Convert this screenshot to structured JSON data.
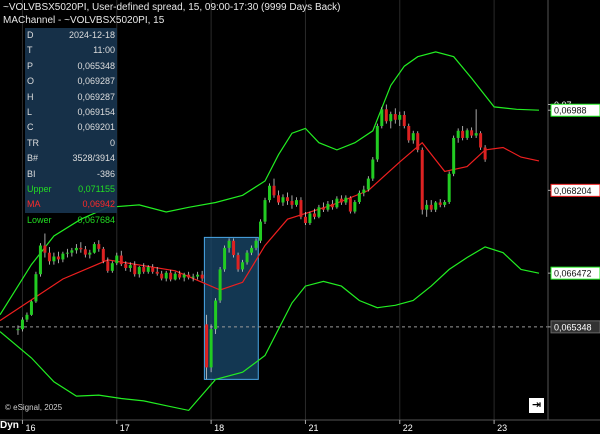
{
  "header": {
    "line1": "~VOLVBSX5020PI, User-defined spread, 15, 09:00-17:30 (9999 Days Back)",
    "line2": "MAChannel - ~VOLVBSX5020PI, 15"
  },
  "data_window": {
    "rows": [
      {
        "key": "D",
        "value": "2024-12-18",
        "color": ""
      },
      {
        "key": "T",
        "value": "11:00",
        "color": ""
      },
      {
        "key": "P",
        "value": "0,065348",
        "color": ""
      },
      {
        "key": "O",
        "value": "0,069287",
        "color": ""
      },
      {
        "key": "H",
        "value": "0,069287",
        "color": ""
      },
      {
        "key": "L",
        "value": "0,069154",
        "color": ""
      },
      {
        "key": "C",
        "value": "0,069201",
        "color": ""
      },
      {
        "key": "TR",
        "value": "0",
        "color": ""
      },
      {
        "key": "B#",
        "value": "3528/3914",
        "color": ""
      },
      {
        "key": "BI",
        "value": "-386",
        "color": ""
      },
      {
        "key": "Upper",
        "value": "0,071155",
        "color": "green"
      },
      {
        "key": "MA",
        "value": "0,06942",
        "color": "red"
      },
      {
        "key": "Lower",
        "value": "0,067684",
        "color": "green"
      }
    ]
  },
  "footer": {
    "copyright": "© eSignal, 2025",
    "dyn_label": "Dyn",
    "goto_end_icon": "goto-end-icon"
  },
  "colors": {
    "background": "#000000",
    "up_candle": "#22cc22",
    "down_candle": "#dd2222",
    "band": "#22ee22",
    "ma": "#ee1f1f",
    "selection_fill": "#1a4a6e",
    "selection_border": "#4aa8e8",
    "axis_tag_bg": "#ffffff"
  },
  "chart_data": {
    "type": "candlestick",
    "x_tick_labels": [
      "16",
      "17",
      "18",
      "21",
      "22",
      "23"
    ],
    "x_tick_positions": [
      1,
      22,
      43,
      64,
      85,
      106
    ],
    "x_range": [
      -4,
      118
    ],
    "y_range": [
      0.0634,
      0.0716
    ],
    "y_axis_labels": [
      {
        "value": 0.07,
        "text": "0,07",
        "style": "tick"
      },
      {
        "value": 0.06988,
        "text": "0,06988",
        "style": "upper"
      },
      {
        "value": 0.068204,
        "text": "0,068204",
        "style": "price"
      },
      {
        "value": 0.066472,
        "text": "0,066472",
        "style": "lower"
      },
      {
        "value": 0.065348,
        "text": "0,065348",
        "style": "cursor"
      }
    ],
    "cursor_price": 0.065348,
    "selection": {
      "x0": 41.5,
      "x1": 53.5,
      "y_top": 0.06722,
      "y_bottom": 0.06425
    },
    "ohlc": [
      [
        0.06528,
        0.06538,
        0.06518,
        0.0653
      ],
      [
        0.0653,
        0.06555,
        0.06525,
        0.0655
      ],
      [
        0.0655,
        0.06565,
        0.06545,
        0.0656
      ],
      [
        0.0656,
        0.0659,
        0.06558,
        0.06588
      ],
      [
        0.06588,
        0.0665,
        0.06585,
        0.06645
      ],
      [
        0.06645,
        0.0671,
        0.0664,
        0.06705
      ],
      [
        0.06705,
        0.0673,
        0.0668,
        0.0669
      ],
      [
        0.0669,
        0.06702,
        0.06665,
        0.06672
      ],
      [
        0.06672,
        0.0669,
        0.06665,
        0.06682
      ],
      [
        0.06682,
        0.06692,
        0.06668,
        0.06676
      ],
      [
        0.06676,
        0.06692,
        0.0667,
        0.06688
      ],
      [
        0.06688,
        0.06698,
        0.0668,
        0.0669
      ],
      [
        0.0669,
        0.067,
        0.06682,
        0.06695
      ],
      [
        0.06695,
        0.06708,
        0.06688,
        0.067
      ],
      [
        0.067,
        0.06712,
        0.0669,
        0.06697
      ],
      [
        0.06697,
        0.06704,
        0.0668,
        0.06686
      ],
      [
        0.06686,
        0.06696,
        0.06678,
        0.0669
      ],
      [
        0.0669,
        0.06712,
        0.06688,
        0.06708
      ],
      [
        0.06708,
        0.06716,
        0.06692,
        0.06698
      ],
      [
        0.06698,
        0.06702,
        0.06668,
        0.06672
      ],
      [
        0.06672,
        0.0668,
        0.06648,
        0.06652
      ],
      [
        0.06652,
        0.06672,
        0.06648,
        0.06668
      ],
      [
        0.06668,
        0.0669,
        0.06664,
        0.06684
      ],
      [
        0.06684,
        0.06694,
        0.06662,
        0.06666
      ],
      [
        0.06666,
        0.06672,
        0.06652,
        0.06658
      ],
      [
        0.06658,
        0.0667,
        0.0665,
        0.06664
      ],
      [
        0.06664,
        0.06672,
        0.0664,
        0.06645
      ],
      [
        0.06645,
        0.06662,
        0.06638,
        0.0666
      ],
      [
        0.0666,
        0.06668,
        0.06646,
        0.0665
      ],
      [
        0.0665,
        0.06664,
        0.06646,
        0.0666
      ],
      [
        0.0666,
        0.06666,
        0.06646,
        0.0665
      ],
      [
        0.0665,
        0.0666,
        0.06642,
        0.06646
      ],
      [
        0.06646,
        0.06652,
        0.06632,
        0.06636
      ],
      [
        0.06636,
        0.06652,
        0.0663,
        0.06648
      ],
      [
        0.06648,
        0.06654,
        0.0663,
        0.06634
      ],
      [
        0.06634,
        0.0665,
        0.06632,
        0.06646
      ],
      [
        0.06646,
        0.06652,
        0.06634,
        0.06638
      ],
      [
        0.06638,
        0.06648,
        0.0663,
        0.06644
      ],
      [
        0.06644,
        0.0665,
        0.06634,
        0.06638
      ],
      [
        0.06638,
        0.06646,
        0.0663,
        0.0664
      ],
      [
        0.0664,
        0.0665,
        0.06634,
        0.06644
      ],
      [
        0.06644,
        0.06652,
        0.0663,
        0.06636
      ],
      [
        0.0654,
        0.0656,
        0.06425,
        0.0645
      ],
      [
        0.0645,
        0.0654,
        0.0644,
        0.0653
      ],
      [
        0.0653,
        0.06595,
        0.0652,
        0.0659
      ],
      [
        0.0659,
        0.0666,
        0.06585,
        0.06655
      ],
      [
        0.06655,
        0.06705,
        0.0665,
        0.067
      ],
      [
        0.067,
        0.0672,
        0.0669,
        0.06715
      ],
      [
        0.06715,
        0.0672,
        0.0668,
        0.06685
      ],
      [
        0.06685,
        0.0669,
        0.0665,
        0.06655
      ],
      [
        0.06655,
        0.06675,
        0.0665,
        0.0667
      ],
      [
        0.0667,
        0.06695,
        0.06665,
        0.0669
      ],
      [
        0.0669,
        0.06705,
        0.06685,
        0.067
      ],
      [
        0.067,
        0.0672,
        0.06695,
        0.06715
      ],
      [
        0.06715,
        0.0676,
        0.0671,
        0.06755
      ],
      [
        0.06755,
        0.06805,
        0.0675,
        0.068
      ],
      [
        0.068,
        0.06835,
        0.06795,
        0.0683
      ],
      [
        0.0683,
        0.06845,
        0.06805,
        0.0681
      ],
      [
        0.0681,
        0.0682,
        0.0679,
        0.06795
      ],
      [
        0.06795,
        0.06812,
        0.06788,
        0.06806
      ],
      [
        0.06806,
        0.06816,
        0.0679,
        0.06798
      ],
      [
        0.06798,
        0.0681,
        0.06782,
        0.0679
      ],
      [
        0.0679,
        0.06806,
        0.06786,
        0.068
      ],
      [
        0.068,
        0.06806,
        0.0676,
        0.06765
      ],
      [
        0.06765,
        0.06775,
        0.06748,
        0.06752
      ],
      [
        0.06752,
        0.06776,
        0.06748,
        0.06772
      ],
      [
        0.06772,
        0.06782,
        0.0676,
        0.06765
      ],
      [
        0.06765,
        0.0679,
        0.06762,
        0.06785
      ],
      [
        0.06785,
        0.06795,
        0.06775,
        0.0678
      ],
      [
        0.0678,
        0.06798,
        0.06776,
        0.06792
      ],
      [
        0.06792,
        0.068,
        0.0678,
        0.06785
      ],
      [
        0.06785,
        0.06808,
        0.06782,
        0.06803
      ],
      [
        0.06803,
        0.0681,
        0.0679,
        0.06795
      ],
      [
        0.06795,
        0.0681,
        0.0679,
        0.06805
      ],
      [
        0.06805,
        0.06808,
        0.06772,
        0.06776
      ],
      [
        0.06776,
        0.068,
        0.06772,
        0.06796
      ],
      [
        0.06796,
        0.0682,
        0.06792,
        0.06815
      ],
      [
        0.06815,
        0.0683,
        0.06808,
        0.06822
      ],
      [
        0.06822,
        0.0685,
        0.06818,
        0.06845
      ],
      [
        0.06845,
        0.0689,
        0.0684,
        0.06885
      ],
      [
        0.06885,
        0.0696,
        0.0688,
        0.06955
      ],
      [
        0.06955,
        0.06995,
        0.0695,
        0.0699
      ],
      [
        0.0699,
        0.07,
        0.0696,
        0.06965
      ],
      [
        0.06965,
        0.06985,
        0.0695,
        0.0698
      ],
      [
        0.0698,
        0.06992,
        0.0696,
        0.06968
      ],
      [
        0.06968,
        0.06985,
        0.06955,
        0.06978
      ],
      [
        0.06978,
        0.06986,
        0.0695,
        0.06955
      ],
      [
        0.06955,
        0.0696,
        0.0692,
        0.06925
      ],
      [
        0.06925,
        0.06945,
        0.06918,
        0.0694
      ],
      [
        0.0694,
        0.06944,
        0.069,
        0.06905
      ],
      [
        0.06905,
        0.0691,
        0.0677,
        0.0678
      ],
      [
        0.0678,
        0.068,
        0.06765,
        0.0679
      ],
      [
        0.0679,
        0.068,
        0.06775,
        0.0678
      ],
      [
        0.0678,
        0.06798,
        0.06775,
        0.06795
      ],
      [
        0.06795,
        0.06802,
        0.06785,
        0.0679
      ],
      [
        0.0679,
        0.068,
        0.06785,
        0.06796
      ],
      [
        0.06796,
        0.0686,
        0.06792,
        0.06855
      ],
      [
        0.06855,
        0.06935,
        0.0685,
        0.0693
      ],
      [
        0.0693,
        0.0695,
        0.0692,
        0.06945
      ],
      [
        0.06945,
        0.06955,
        0.06925,
        0.0693
      ],
      [
        0.0693,
        0.0695,
        0.06926,
        0.06946
      ],
      [
        0.06946,
        0.06952,
        0.0693,
        0.06935
      ],
      [
        0.06935,
        0.0699,
        0.0693,
        0.0694
      ],
      [
        0.0694,
        0.06944,
        0.06905,
        0.0691
      ],
      [
        0.0691,
        0.06915,
        0.0688,
        0.06885
      ]
    ],
    "ma": {
      "name": "MA",
      "points": [
        [
          -4,
          0.06548
        ],
        [
          10,
          0.06635
        ],
        [
          20,
          0.06675
        ],
        [
          35,
          0.06652
        ],
        [
          41,
          0.06628
        ],
        [
          45,
          0.06612
        ],
        [
          50,
          0.06628
        ],
        [
          55,
          0.06705
        ],
        [
          60,
          0.0676
        ],
        [
          70,
          0.0679
        ],
        [
          78,
          0.0682
        ],
        [
          85,
          0.0688
        ],
        [
          90,
          0.0692
        ],
        [
          95,
          0.0686
        ],
        [
          100,
          0.0687
        ],
        [
          104,
          0.06905
        ],
        [
          108,
          0.0691
        ],
        [
          112,
          0.0689
        ],
        [
          116,
          0.06882
        ]
      ]
    },
    "upper_band": {
      "name": "Upper",
      "points": [
        [
          -4,
          0.0656
        ],
        [
          3,
          0.06665
        ],
        [
          8,
          0.06725
        ],
        [
          14,
          0.0676
        ],
        [
          20,
          0.06785
        ],
        [
          27,
          0.0679
        ],
        [
          33,
          0.06775
        ],
        [
          38,
          0.06785
        ],
        [
          44,
          0.06795
        ],
        [
          50,
          0.0681
        ],
        [
          55,
          0.0684
        ],
        [
          58,
          0.06895
        ],
        [
          61,
          0.0694
        ],
        [
          64,
          0.0695
        ],
        [
          67,
          0.0692
        ],
        [
          71,
          0.06905
        ],
        [
          75,
          0.0692
        ],
        [
          79,
          0.06945
        ],
        [
          83,
          0.0704
        ],
        [
          86,
          0.0708
        ],
        [
          89,
          0.071
        ],
        [
          93,
          0.0711
        ],
        [
          97,
          0.071
        ],
        [
          101,
          0.07055
        ],
        [
          106,
          0.06995
        ],
        [
          111,
          0.0699
        ],
        [
          116,
          0.06988
        ]
      ]
    },
    "lower_band": {
      "name": "Lower",
      "points": [
        [
          -4,
          0.06525
        ],
        [
          3,
          0.0647
        ],
        [
          8,
          0.0642
        ],
        [
          13,
          0.0639
        ],
        [
          18,
          0.06392
        ],
        [
          23,
          0.06385
        ],
        [
          28,
          0.0638
        ],
        [
          33,
          0.0637
        ],
        [
          38,
          0.0636
        ],
        [
          44,
          0.06425
        ],
        [
          50,
          0.0644
        ],
        [
          55,
          0.06475
        ],
        [
          58,
          0.0653
        ],
        [
          61,
          0.06585
        ],
        [
          64,
          0.0662
        ],
        [
          68,
          0.0663
        ],
        [
          72,
          0.0662
        ],
        [
          76,
          0.0659
        ],
        [
          80,
          0.06575
        ],
        [
          84,
          0.0658
        ],
        [
          88,
          0.0659
        ],
        [
          92,
          0.0662
        ],
        [
          96,
          0.06655
        ],
        [
          100,
          0.0668
        ],
        [
          104,
          0.06702
        ],
        [
          108,
          0.0669
        ],
        [
          112,
          0.06655
        ],
        [
          116,
          0.06647
        ]
      ]
    }
  }
}
